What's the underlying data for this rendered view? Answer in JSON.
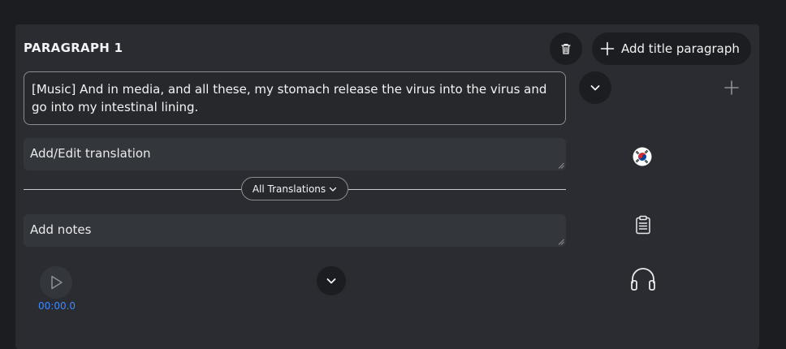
{
  "paragraph": {
    "title": "PARAGRAPH 1",
    "add_title_label": "Add title paragraph",
    "transcript_text": "[Music] And in media, and all these, my stomach release the virus into the virus and go into my intestinal lining.",
    "translation_placeholder": "Add/Edit translation",
    "translations_label": "All Translations",
    "notes_placeholder": "Add notes",
    "time": "00:00.0"
  },
  "icons": {
    "trash": "trash-icon",
    "plus": "plus-icon",
    "chevron": "chevron-down-icon",
    "flag": "south-korea-flag-icon",
    "clipboard": "clipboard-icon",
    "play": "play-icon",
    "headphones": "headphones-icon"
  },
  "colors": {
    "background": "#1c1d20",
    "card": "#2a2c31",
    "field": "#33363b",
    "accent_time": "#3d8bff"
  }
}
